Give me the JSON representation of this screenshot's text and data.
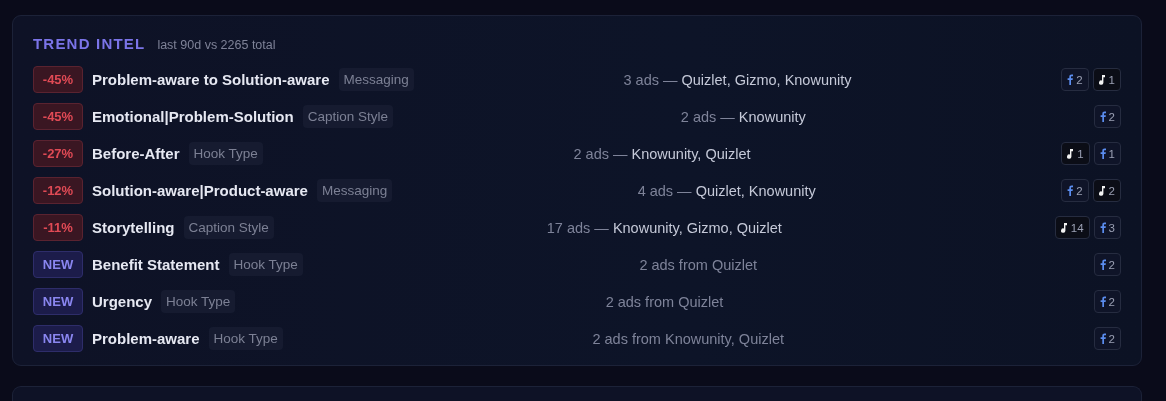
{
  "panel": {
    "title": "TREND INTEL",
    "subtitle": "last 90d vs 2265 total"
  },
  "trends": [
    {
      "badge": {
        "kind": "drop",
        "label": "-45%"
      },
      "name": "Problem-aware to Solution-aware",
      "category": "Messaging",
      "ads": "3 ads —",
      "brands": "Quizlet, Gizmo, Knowunity",
      "platforms": [
        {
          "kind": "facebook",
          "count": "2"
        },
        {
          "kind": "tiktok",
          "count": "1"
        }
      ]
    },
    {
      "badge": {
        "kind": "drop",
        "label": "-45%"
      },
      "name": "Emotional|Problem-Solution",
      "category": "Caption Style",
      "ads": "2 ads —",
      "brands": "Knowunity",
      "platforms": [
        {
          "kind": "facebook",
          "count": "2"
        }
      ]
    },
    {
      "badge": {
        "kind": "drop",
        "label": "-27%"
      },
      "name": "Before-After",
      "category": "Hook Type",
      "ads": "2 ads —",
      "brands": "Knowunity, Quizlet",
      "platforms": [
        {
          "kind": "tiktok",
          "count": "1"
        },
        {
          "kind": "facebook",
          "count": "1"
        }
      ]
    },
    {
      "badge": {
        "kind": "drop",
        "label": "-12%"
      },
      "name": "Solution-aware|Product-aware",
      "category": "Messaging",
      "ads": "4 ads —",
      "brands": "Quizlet, Knowunity",
      "platforms": [
        {
          "kind": "facebook",
          "count": "2"
        },
        {
          "kind": "tiktok",
          "count": "2"
        }
      ]
    },
    {
      "badge": {
        "kind": "drop",
        "label": "-11%"
      },
      "name": "Storytelling",
      "category": "Caption Style",
      "ads": "17 ads —",
      "brands": "Knowunity, Gizmo, Quizlet",
      "platforms": [
        {
          "kind": "tiktok",
          "count": "14"
        },
        {
          "kind": "facebook",
          "count": "3"
        }
      ]
    },
    {
      "badge": {
        "kind": "new",
        "label": "NEW"
      },
      "name": "Benefit Statement",
      "category": "Hook Type",
      "ads": "2 ads from Quizlet",
      "platforms": [
        {
          "kind": "facebook",
          "count": "2"
        }
      ]
    },
    {
      "badge": {
        "kind": "new",
        "label": "NEW"
      },
      "name": "Urgency",
      "category": "Hook Type",
      "ads": "2 ads from Quizlet",
      "platforms": [
        {
          "kind": "facebook",
          "count": "2"
        }
      ]
    },
    {
      "badge": {
        "kind": "new",
        "label": "NEW"
      },
      "name": "Problem-aware",
      "category": "Hook Type",
      "ads": "2 ads from Knowunity, Quizlet",
      "platforms": [
        {
          "kind": "facebook",
          "count": "2"
        }
      ]
    }
  ]
}
